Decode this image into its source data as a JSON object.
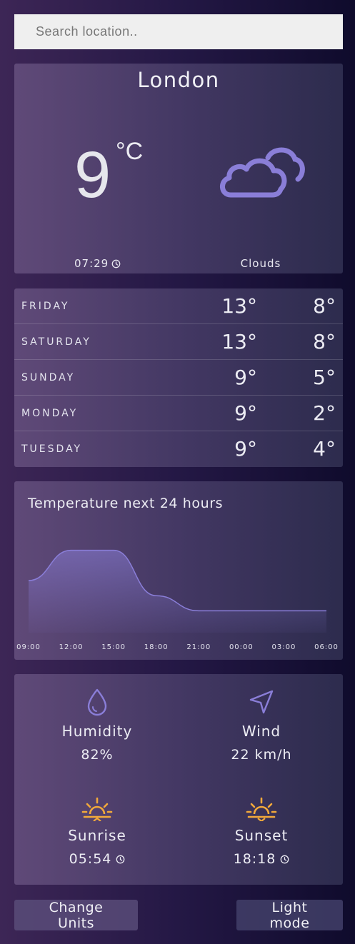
{
  "search": {
    "placeholder": "Search location.."
  },
  "current": {
    "city": "London",
    "temperature": "9",
    "unit": "°C",
    "time": "07:29",
    "condition": "Clouds",
    "icon": "cloud-icon",
    "icon_color": "#8a7ed8"
  },
  "forecast": [
    {
      "day": "FRIDAY",
      "high": "13°",
      "low": "8°"
    },
    {
      "day": "SATURDAY",
      "high": "13°",
      "low": "8°"
    },
    {
      "day": "SUNDAY",
      "high": "9°",
      "low": "5°"
    },
    {
      "day": "MONDAY",
      "high": "9°",
      "low": "2°"
    },
    {
      "day": "TUESDAY",
      "high": "9°",
      "low": "4°"
    }
  ],
  "chart_data": {
    "type": "area",
    "title": "Temperature next 24 hours",
    "categories": [
      "09:00",
      "12:00",
      "15:00",
      "18:00",
      "21:00",
      "00:00",
      "03:00",
      "06:00"
    ],
    "values": [
      9,
      13,
      13,
      7,
      5,
      5,
      5,
      5
    ],
    "ylim": [
      4,
      14
    ],
    "grid": false,
    "line_color": "#8a7ed8"
  },
  "details": {
    "humidity": {
      "label": "Humidity",
      "value": "82%",
      "icon": "droplet-icon"
    },
    "wind": {
      "label": "Wind",
      "value": "22 km/h",
      "icon": "navigation-arrow-icon"
    },
    "sunrise": {
      "label": "Sunrise",
      "value": "05:54",
      "icon": "sunrise-icon"
    },
    "sunset": {
      "label": "Sunset",
      "value": "18:18",
      "icon": "sunset-icon"
    },
    "accent_color": "#8a7ed8",
    "sun_color": "#f2a93b"
  },
  "buttons": {
    "units_label": "Change Units",
    "mode_label": "Light mode"
  }
}
